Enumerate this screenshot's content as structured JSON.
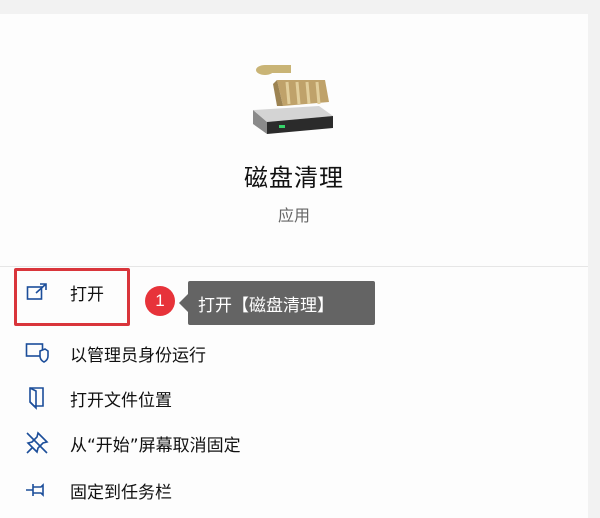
{
  "app": {
    "name": "磁盘清理",
    "type": "应用",
    "icon": "disk-cleanup-icon"
  },
  "menu": {
    "items": [
      {
        "label": "打开",
        "icon": "open-external-icon"
      },
      {
        "label": "以管理员身份运行",
        "icon": "admin-shield-icon"
      },
      {
        "label": "打开文件位置",
        "icon": "file-location-icon"
      },
      {
        "label": "从“开始”屏幕取消固定",
        "icon": "unpin-icon"
      },
      {
        "label": "固定到任务栏",
        "icon": "pin-taskbar-icon"
      }
    ]
  },
  "annotation": {
    "step_number": "1",
    "tooltip": "打开【磁盘清理】",
    "highlight_color": "#d9353b",
    "badge_color": "#e7333a"
  },
  "colors": {
    "icon_blue": "#1c4e9a",
    "tooltip_bg": "#646464"
  }
}
